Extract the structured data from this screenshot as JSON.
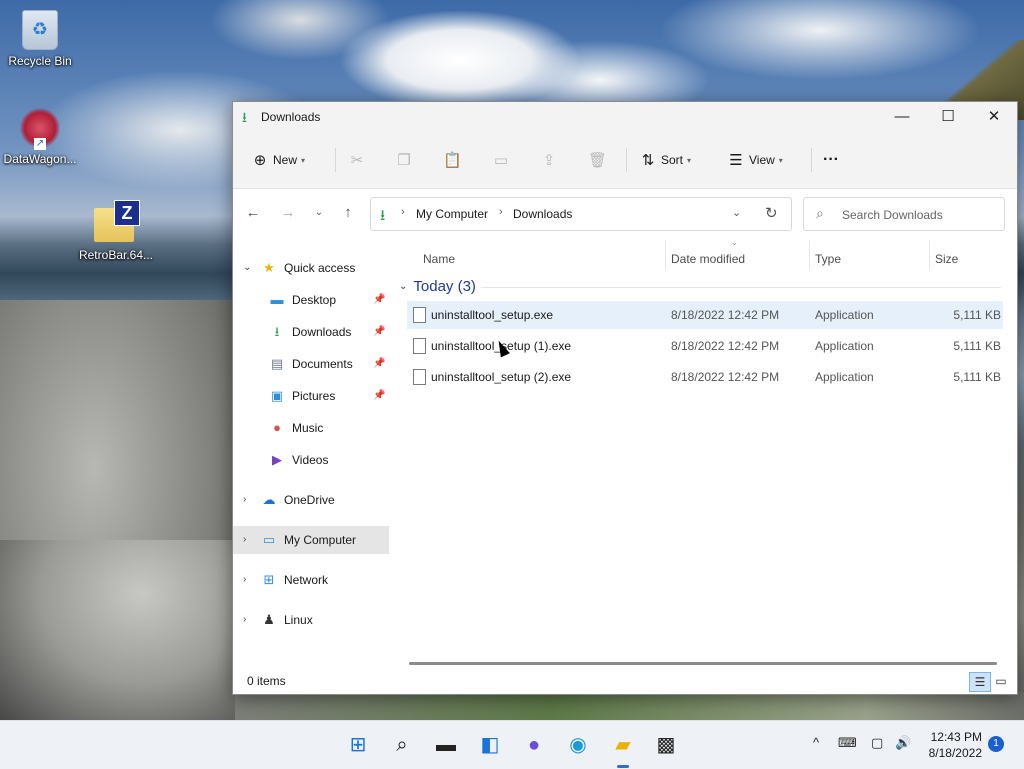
{
  "desktop": {
    "icons": [
      {
        "label": "Recycle Bin"
      },
      {
        "label": "DataWagon..."
      },
      {
        "label": "RetroBar.64..."
      }
    ]
  },
  "window": {
    "title": "Downloads",
    "toolbar": {
      "new_label": "New",
      "sort_label": "Sort",
      "view_label": "View",
      "more_label": "···"
    },
    "address": {
      "crumbs": [
        "My Computer",
        "Downloads"
      ]
    },
    "search": {
      "placeholder": "Search Downloads"
    },
    "nav": {
      "quick_access": "Quick access",
      "items": [
        {
          "label": "Desktop",
          "icon": "desktop-icon",
          "pinned": true
        },
        {
          "label": "Downloads",
          "icon": "download-icon",
          "pinned": true
        },
        {
          "label": "Documents",
          "icon": "document-icon",
          "pinned": true
        },
        {
          "label": "Pictures",
          "icon": "picture-icon",
          "pinned": true
        },
        {
          "label": "Music",
          "icon": "music-icon",
          "pinned": false
        },
        {
          "label": "Videos",
          "icon": "video-icon",
          "pinned": false
        }
      ],
      "roots": [
        {
          "label": "OneDrive",
          "icon": "cloud-icon"
        },
        {
          "label": "My Computer",
          "icon": "computer-icon",
          "selected": true
        },
        {
          "label": "Network",
          "icon": "network-icon"
        },
        {
          "label": "Linux",
          "icon": "penguin-icon"
        }
      ]
    },
    "columns": {
      "name": "Name",
      "date": "Date modified",
      "type": "Type",
      "size": "Size"
    },
    "group": {
      "label": "Today (3)"
    },
    "files": [
      {
        "name": "uninstalltool_setup.exe",
        "date": "8/18/2022 12:42 PM",
        "type": "Application",
        "size": "5,111 KB"
      },
      {
        "name": "uninstalltool_setup (1).exe",
        "date": "8/18/2022 12:42 PM",
        "type": "Application",
        "size": "5,111 KB"
      },
      {
        "name": "uninstalltool_setup (2).exe",
        "date": "8/18/2022 12:42 PM",
        "type": "Application",
        "size": "5,111 KB"
      }
    ],
    "status": {
      "items": "0 items"
    }
  },
  "taskbar": {
    "clock_time": "12:43 PM",
    "clock_date": "8/18/2022",
    "notification_count": "1"
  },
  "colors": {
    "accent": "#1a5fd0",
    "downloads_green": "#22a14a",
    "hover_row": "#e5f0fb",
    "group_blue": "#1f3a93"
  }
}
